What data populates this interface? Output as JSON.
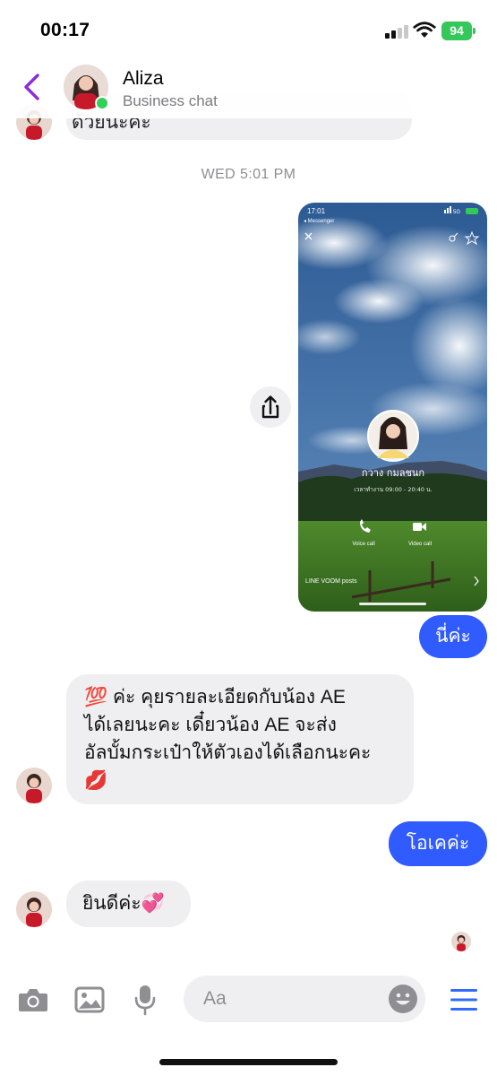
{
  "status_bar": {
    "time": "00:17",
    "battery": "94"
  },
  "header": {
    "name": "Aliza",
    "subtitle": "Business chat"
  },
  "messages": {
    "top_partial": "ด้วยนะคะ",
    "timestamp": "WED 5:01 PM",
    "shared_image": {
      "time": "17:01",
      "back_label": "◂ Messenger",
      "network": "5G",
      "profile_name": "กวาง กมลชนก",
      "hours": "เวลาทำงาน 09:00 - 20:40 น.",
      "voice_call_label": "Voice call",
      "video_call_label": "Video call",
      "voom_label": "LINE VOOM posts"
    },
    "out_1": "นี่ค่ะ",
    "in_1": {
      "line1": "💯 ค่ะ คุยรายละเอียดกับน้อง AE",
      "line2": "ได้เลยนะคะ เดี๋ยวน้อง AE จะส่ง",
      "line3": "อัลบั้มกระเป๋าให้ตัวเองได้เลือกนะคะ",
      "line4": "💋"
    },
    "out_2": "โอเคค่ะ",
    "in_2": "ยินดีค่ะ💞"
  },
  "composer": {
    "placeholder": "Aa"
  },
  "colors": {
    "accent": "#2f5bff",
    "back": "#8a2be2",
    "online": "#31d158",
    "battery": "#34c759"
  }
}
